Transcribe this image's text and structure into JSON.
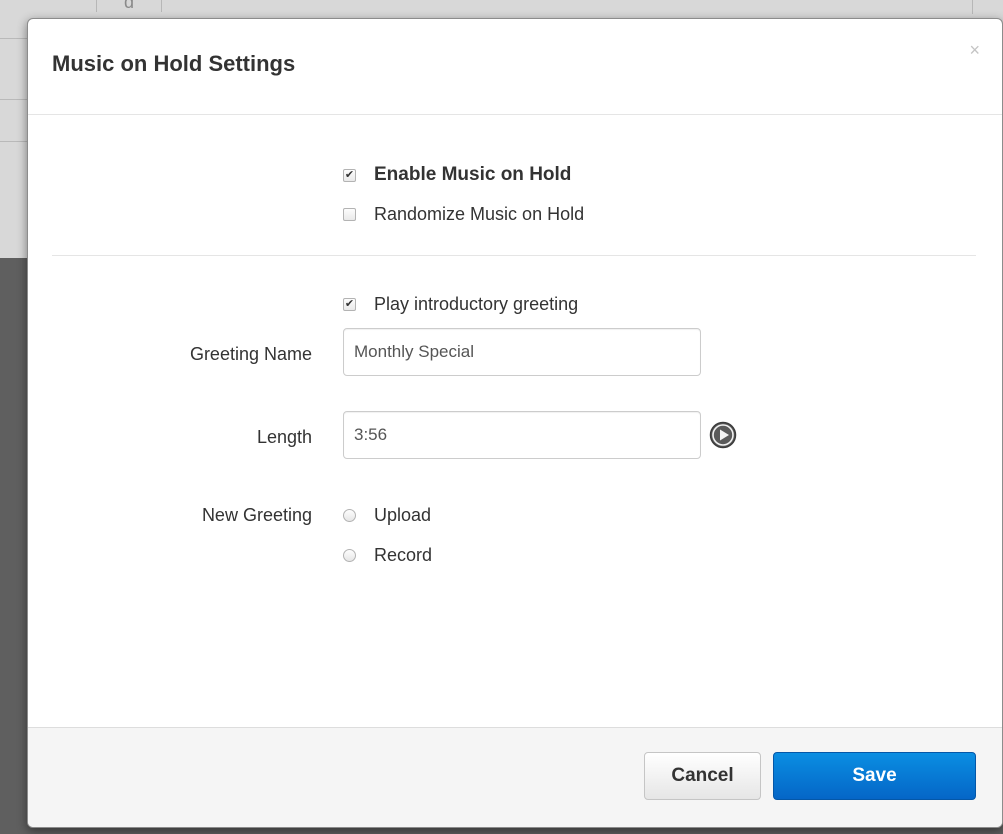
{
  "background": {
    "fragment_text": "d"
  },
  "modal": {
    "title": "Music on Hold Settings",
    "close_symbol": "×",
    "enable_music_on_hold": {
      "label": "Enable Music on Hold",
      "checked": true
    },
    "randomize_music_on_hold": {
      "label": "Randomize Music on Hold",
      "checked": false
    },
    "play_introductory_greeting": {
      "label": "Play introductory greeting",
      "checked": true
    },
    "greeting_name": {
      "label": "Greeting Name",
      "value": "Monthly Special"
    },
    "length": {
      "label": "Length",
      "value": "3:56",
      "play_icon": "play-circle-icon"
    },
    "new_greeting": {
      "label": "New Greeting",
      "options": [
        {
          "label": "Upload",
          "selected": false
        },
        {
          "label": "Record",
          "selected": false
        }
      ]
    },
    "footer": {
      "cancel_label": "Cancel",
      "save_label": "Save"
    }
  },
  "colors": {
    "save_button": "#0566c7",
    "overlay": "#5e5e5e"
  }
}
